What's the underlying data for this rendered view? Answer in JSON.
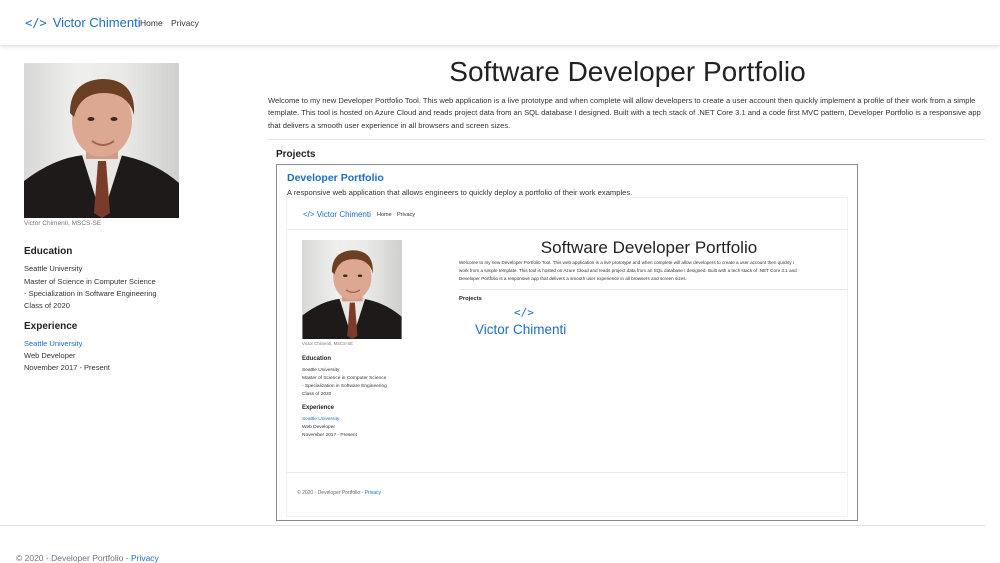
{
  "navbar": {
    "brand_icon": "</>",
    "brand_name": "Victor Chimenti",
    "links": [
      "Home",
      "Privacy"
    ]
  },
  "sidebar": {
    "photo_caption": "Victor Chimenti, MSCS-SE",
    "education": {
      "heading": "Education",
      "lines": [
        "Seattle University",
        "Master of Science in Computer Science",
        "- Specialization in Software Engineering",
        "Class of 2020"
      ]
    },
    "experience": {
      "heading": "Experience",
      "employer": "Seattle University",
      "role": "Web Developer",
      "dates": "November 2017 - Present"
    }
  },
  "main": {
    "title": "Software Developer Portfolio",
    "intro": "Welcome to my new Developer Portfolio Tool. This web application is a live prototype and when complete will allow developers to create a user account then quickly implement a profile of their work from a simple template. This tool is hosted on Azure Cloud and reads project data from an SQL database I designed. Built with a tech stack of .NET Core 3.1 and a code first MVC pattern, Developer Portfolio is a responsive app that delivers a smooth user experience in all browsers and screen sizes.",
    "projects_heading": "Projects",
    "project": {
      "title": "Developer Portfolio",
      "description": "A responsive web application that allows engineers to quickly deploy a portfolio of their work examples.",
      "thumbnail": {
        "brand": "</> Victor Chimenti",
        "nav_links": [
          "Home",
          "Privacy"
        ],
        "photo_caption": "Victor Chimenti, MSCS-SE",
        "education_heading": "Education",
        "education_lines": [
          "Seattle University",
          "Master of Science in Computer Science",
          "- Specialization in Software Engineering",
          "Class of 2020"
        ],
        "experience_heading": "Experience",
        "experience_lines": [
          "Seattle University",
          "Web Developer",
          "November 2017 - Present"
        ],
        "title": "Software Developer Portfolio",
        "intro_lines": [
          "Welcome to my new Developer Portfolio Tool. This web application is a live prototype and when complete will allow developers to create a user account then quickly i",
          "work from a simple template. This tool is hosted on Azure Cloud and reads project data from an SQL database I designed. Built with a tech stack of .NET Core 3.1 and",
          "Developer Portfolio is a responsive app that delivers a smooth user experience in all browsers and screen sizes."
        ],
        "projects_heading": "Projects",
        "logo_icon": "</>",
        "logo_name": "Victor Chimenti",
        "footer_text": "© 2020 - Developer Portfolio - ",
        "footer_link": "Privacy"
      }
    }
  },
  "footer": {
    "text": "© 2020 - Developer Portfolio - ",
    "link": "Privacy"
  },
  "colors": {
    "accent": "#1b6ec2",
    "text": "#212529"
  },
  "icons": [
    "code-brackets-icon"
  ]
}
